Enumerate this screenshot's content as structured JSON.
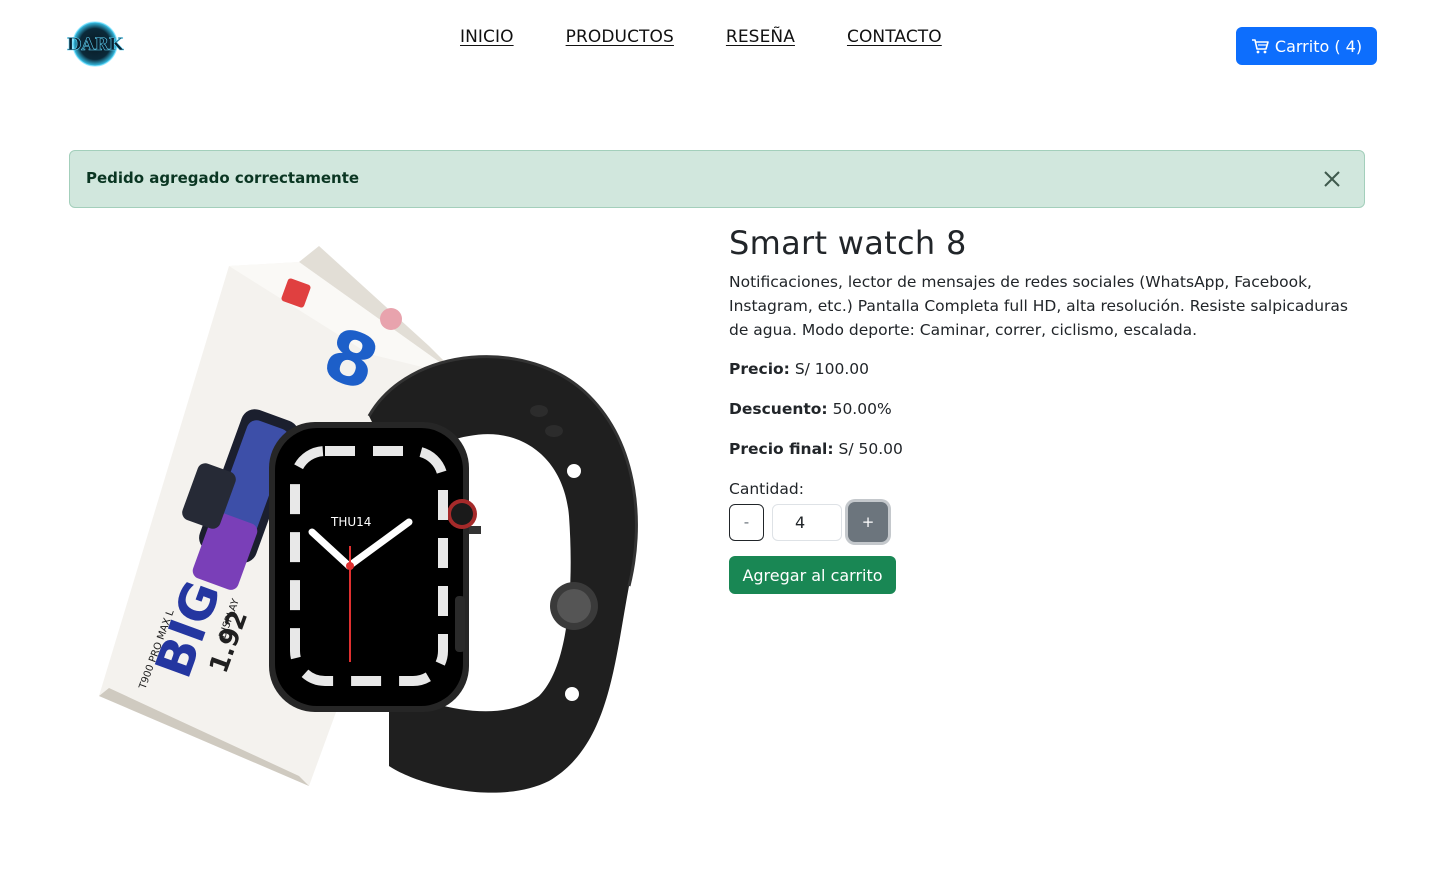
{
  "brand": {
    "logo_text": "DARK",
    "logo_icon": "dark-logo"
  },
  "nav": {
    "items": [
      {
        "label": "INICIO"
      },
      {
        "label": "PRODUCTOS"
      },
      {
        "label": "RESEÑA"
      },
      {
        "label": "CONTACTO"
      }
    ]
  },
  "cart": {
    "icon": "cart-icon",
    "label": "Carrito ( 4)",
    "color": "#0d6efd"
  },
  "alert": {
    "message": "Pedido agregado correctamente",
    "close_icon": "close-icon",
    "background": "#d1e7dd"
  },
  "product": {
    "image_icon": "smart-watch-image",
    "image_texts": {
      "box_number": "8",
      "box_model": "T900 PRO MAX L",
      "box_big": "BIG",
      "box_size": "1.92",
      "box_display": "DISPLAY",
      "watch_day": "THU14"
    },
    "title": "Smart watch 8",
    "description": "Notificaciones, lector de mensajes de redes sociales (WhatsApp, Facebook, Instagram, etc.) Pantalla Completa full HD, alta resolución. Resiste salpicaduras de agua. Modo deporte: Caminar, correr, ciclismo, escalada.",
    "price_label": "Precio:",
    "price_value": "S/ 100.00",
    "discount_label": "Descuento:",
    "discount_value": "50.00%",
    "final_label": "Precio final:",
    "final_value": "S/ 50.00",
    "quantity_label": "Cantidad:",
    "quantity_minus": "-",
    "quantity_value": "4",
    "quantity_plus": "+",
    "add_button": "Agregar al carrito",
    "add_button_color": "#198754"
  }
}
